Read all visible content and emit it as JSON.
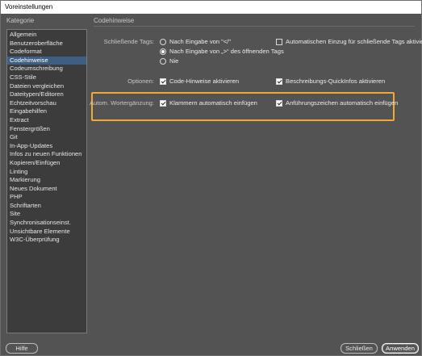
{
  "window": {
    "title": "Voreinstellungen"
  },
  "left_title": "Kategorie",
  "right_title": "Codehinweise",
  "categories": [
    "Allgemein",
    "Benutzeroberfläche",
    "Codeformat",
    "Codehinweise",
    "Codeumschreibung",
    "CSS-Stile",
    "Dateien vergleichen",
    "Dateitypen/Editoren",
    "Echtzeitvorschau",
    "Eingabehilfen",
    "Extract",
    "Fenstergrößen",
    "Git",
    "In-App-Updates",
    "Infos zu neuen Funktionen",
    "Kopieren/Einfügen",
    "Linting",
    "Markierung",
    "Neues Dokument",
    "PHP",
    "Schriftarten",
    "Site",
    "Synchronisationseinst.",
    "Unsichtbare Elemente",
    "W3C-Überprüfung"
  ],
  "selected_category": "Codehinweise",
  "closing_tags": {
    "label": "Schließende Tags:",
    "options": [
      "Nach Eingabe von \"</\"",
      "Nach Eingabe von „>“ des öffnenden Tags",
      "Nie"
    ],
    "selected_index": 1,
    "auto_indent_label": "Automatischen Einzug für schließende Tags aktivieren",
    "auto_indent_checked": false
  },
  "options": {
    "label": "Optionen:",
    "code_hints_label": "Code-Hinweise aktivieren",
    "code_hints_checked": true,
    "quickinfo_label": "Beschreibungs-QuickInfos aktivieren",
    "quickinfo_checked": true
  },
  "autocomplete": {
    "label": "Autom. Wortergänzung:",
    "brackets_label": "Klammern automatisch einfügen",
    "brackets_checked": true,
    "quotes_label": "Anführungszeichen automatisch einfügen",
    "quotes_checked": true
  },
  "buttons": {
    "help": "Hilfe",
    "close": "Schließen",
    "apply": "Anwenden"
  },
  "colors": {
    "highlight": "#f2a832",
    "selection": "#3f5f82"
  }
}
